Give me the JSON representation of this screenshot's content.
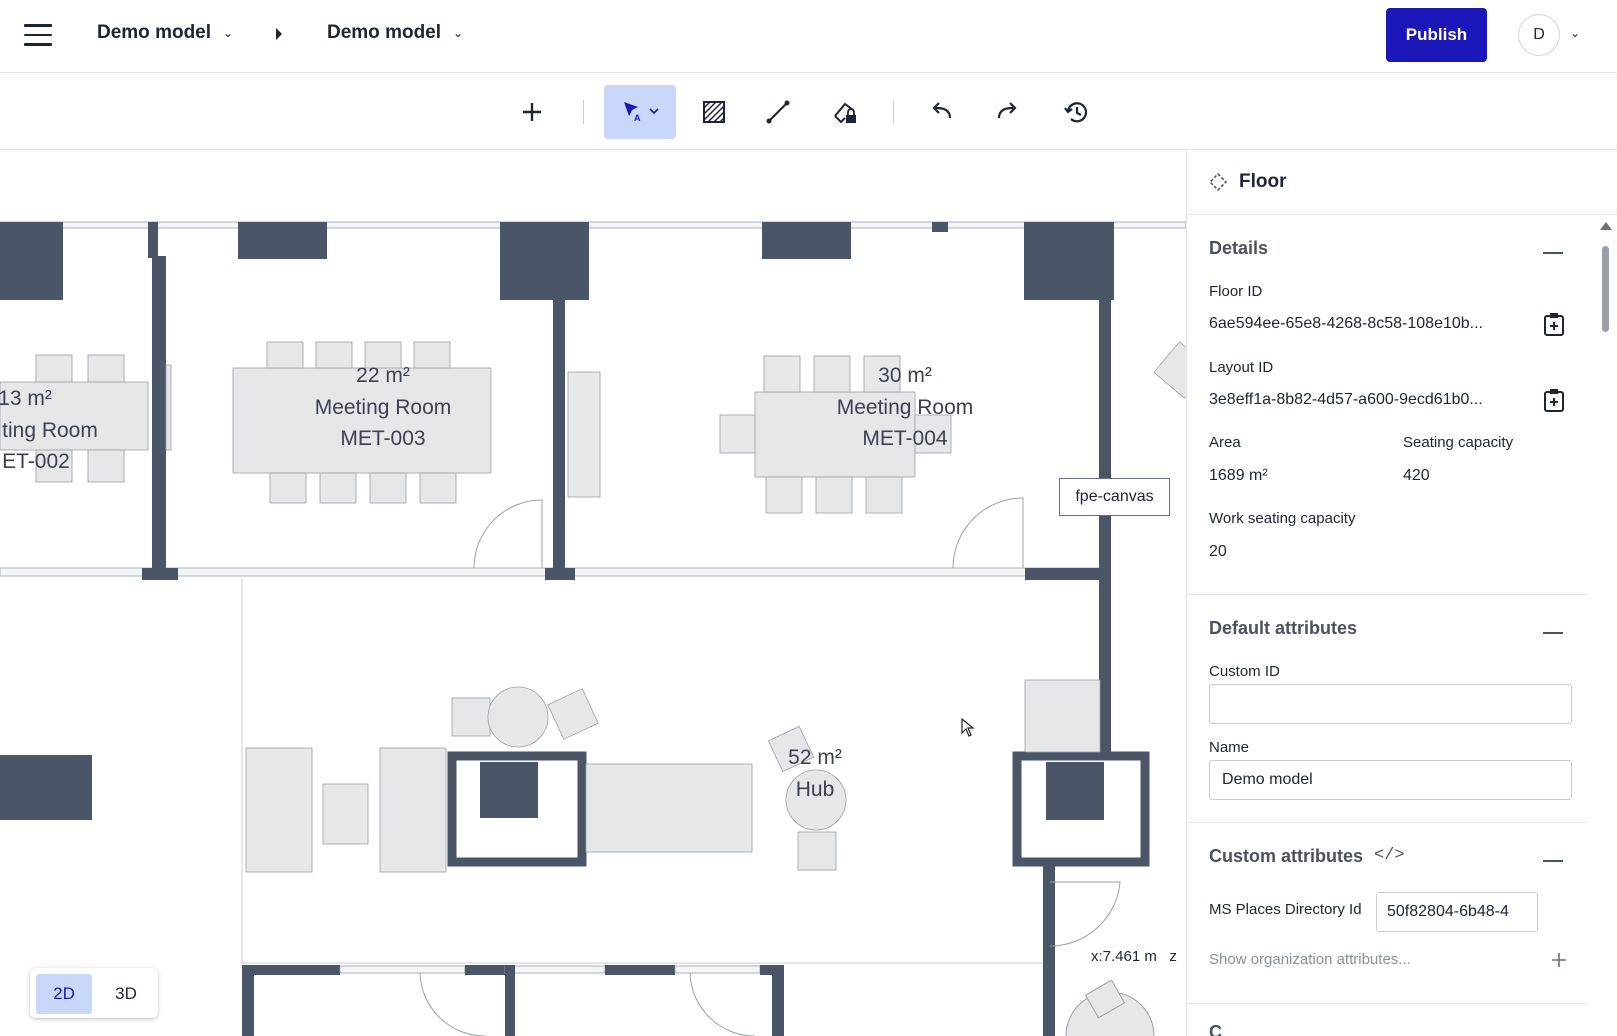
{
  "breadcrumb": {
    "item1": "Demo model",
    "item2": "Demo model"
  },
  "topbar": {
    "publish_label": "Publish",
    "avatar_initial": "D"
  },
  "toolbar": {
    "tools": [
      "add-icon",
      "select-icon",
      "hatch-icon",
      "line-icon",
      "lock-fill-icon",
      "undo-icon",
      "redo-icon",
      "history-icon"
    ]
  },
  "canvas": {
    "rooms": [
      {
        "area": "13 m²",
        "type": "ting Room",
        "code": "ET-002"
      },
      {
        "area": "22 m²",
        "type": "Meeting Room",
        "code": "MET-003"
      },
      {
        "area": "30 m²",
        "type": "Meeting Room",
        "code": "MET-004"
      },
      {
        "area": "52 m²",
        "type": "Hub"
      }
    ],
    "tooltip": "fpe-canvas",
    "coord_readout": "x:7.461 m",
    "coord_cut": "z",
    "mode": {
      "two_d": "2D",
      "three_d": "3D",
      "selected": "2D"
    }
  },
  "panel": {
    "title": "Floor",
    "details": {
      "title": "Details",
      "floor_id_label": "Floor ID",
      "floor_id_value": "6ae594ee-65e8-4268-8c58-108e10b...",
      "layout_id_label": "Layout ID",
      "layout_id_value": "3e8eff1a-8b82-4d57-a600-9ecd61b0...",
      "area_label": "Area",
      "area_value": "1689 m²",
      "seating_label": "Seating capacity",
      "seating_value": "420",
      "work_seating_label": "Work seating capacity",
      "work_seating_value": "20"
    },
    "default_attributes": {
      "title": "Default attributes",
      "custom_id_label": "Custom ID",
      "custom_id_value": "",
      "name_label": "Name",
      "name_value": "Demo model"
    },
    "custom_attributes": {
      "title": "Custom attributes",
      "code_icon": "</>",
      "ms_places_label": "MS Places Directory Id",
      "ms_places_value": "50f82804-6b48-4",
      "show_org": "Show organization attributes..."
    },
    "next_section": "C"
  }
}
